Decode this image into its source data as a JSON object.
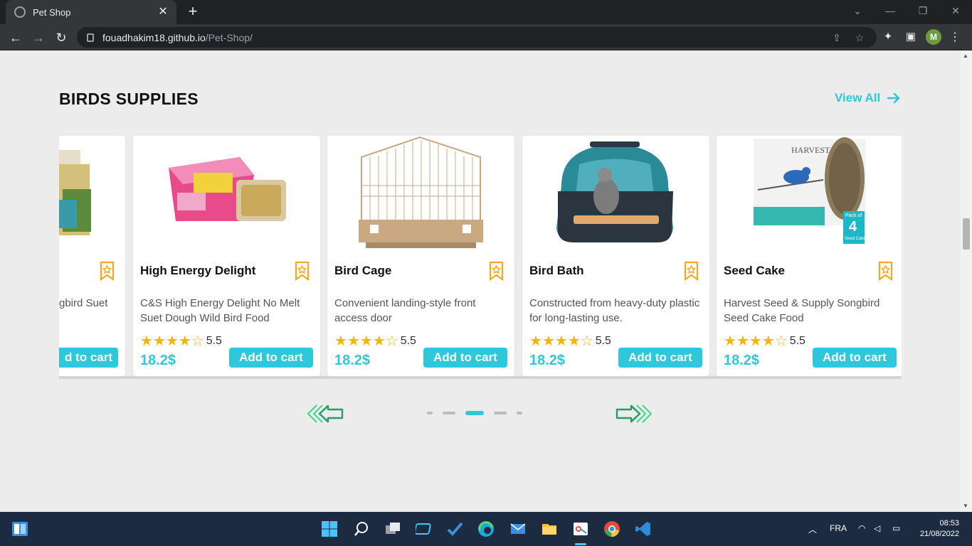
{
  "browser": {
    "tab_title": "Pet Shop",
    "url_host": "fouadhakim18.github.io",
    "url_path": "/Pet-Shop/",
    "profile_initial": "M"
  },
  "section": {
    "title": "BIRDS SUPPLIES",
    "view_all": "View All"
  },
  "products": [
    {
      "name": "",
      "desc": "gbird Suet",
      "rating": "",
      "price": "",
      "cart": "d to cart"
    },
    {
      "name": "High Energy Delight",
      "desc": "C&S High Energy Delight No Melt Suet Dough Wild Bird Food",
      "rating": "5.5",
      "price": "18.2$",
      "cart": "Add to cart"
    },
    {
      "name": "Bird Cage",
      "desc": "Convenient landing-style front access door",
      "rating": "5.5",
      "price": "18.2$",
      "cart": "Add to cart"
    },
    {
      "name": "Bird Bath",
      "desc": "Constructed from heavy-duty plastic for long-lasting use.",
      "rating": "5.5",
      "price": "18.2$",
      "cart": "Add to cart"
    },
    {
      "name": "Seed Cake",
      "desc": "Harvest Seed & Supply Songbird Seed Cake Food",
      "rating": "5.5",
      "price": "18.2$",
      "cart": "Add to cart"
    }
  ],
  "product_images": {
    "harvest_brand": "HARVEST",
    "pack_label": "Pack of",
    "pack_count": "4",
    "pack_unit": "Seed Cakes"
  },
  "pagination": {
    "count": 5,
    "active_index": 2
  },
  "taskbar": {
    "language": "FRA",
    "time": "08:53",
    "date": "21/08/2022"
  },
  "colors": {
    "accent": "#2ec8d8",
    "star": "#f7b500",
    "bookmark": "#f5a623",
    "arrow": "#3ad88c"
  }
}
